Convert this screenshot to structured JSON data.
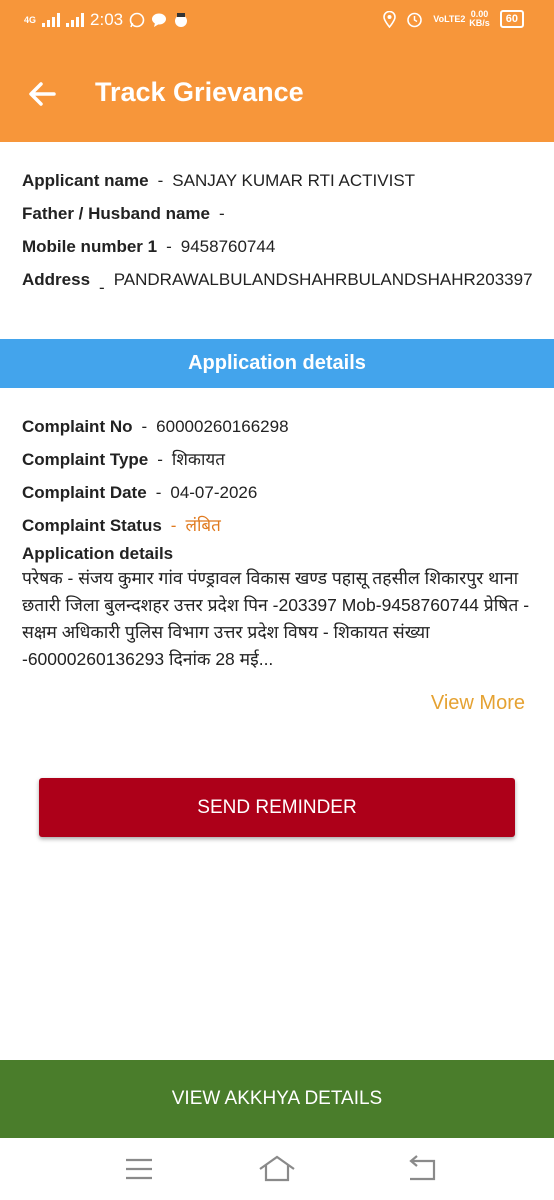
{
  "status_bar": {
    "network": "4G",
    "time": "2:03",
    "volte": "VoLTE2",
    "speed_value": "0.00",
    "speed_unit": "KB/s",
    "battery": "60"
  },
  "app_bar": {
    "title": "Track Grievance"
  },
  "applicant": {
    "rows": [
      {
        "label": "Applicant name",
        "value": "SANJAY KUMAR RTI ACTIVIST"
      },
      {
        "label": "Father / Husband name",
        "value": ""
      },
      {
        "label": "Mobile number 1",
        "value": "9458760744"
      },
      {
        "label": "Address",
        "value": "PANDRAWALBULANDSHAHRBULANDSHAHR203397"
      }
    ]
  },
  "section_header": "Application details",
  "complaint": {
    "no_label": "Complaint No",
    "no": "60000260166298",
    "type_label": "Complaint Type",
    "type": "शिकायत",
    "date_label": "Complaint Date",
    "date": "04-07-2026",
    "status_label": "Complaint Status",
    "status": "लंबित",
    "details_label": "Application details",
    "details_text": "परेषक - संजय कुमार  गांव पंण्ड्रावल विकास खण्ड पहासू तहसील शिकारपुर थाना छतारी जिला बुलन्दशहर उत्तर प्रदेश पिन -203397 Mob-9458760744 प्रेषित -  सक्षम अधिकारी    पुलिस विभाग उत्तर प्रदेश  विषय - शिकायत संख्या -60000260136293 दिनांक 28 मई..."
  },
  "view_more": "View More",
  "send_reminder": "SEND REMINDER",
  "view_akkhya": "VIEW AKKHYA DETAILS",
  "colors": {
    "header": "#f7963a",
    "section": "#43a4ec",
    "reminder": "#ad0019",
    "akkhya": "#4a7d2b",
    "status": "#e07a1f",
    "view_more": "#e5a232"
  },
  "icons": [
    "back-arrow-icon",
    "menu-icon",
    "home-icon",
    "back-icon"
  ]
}
